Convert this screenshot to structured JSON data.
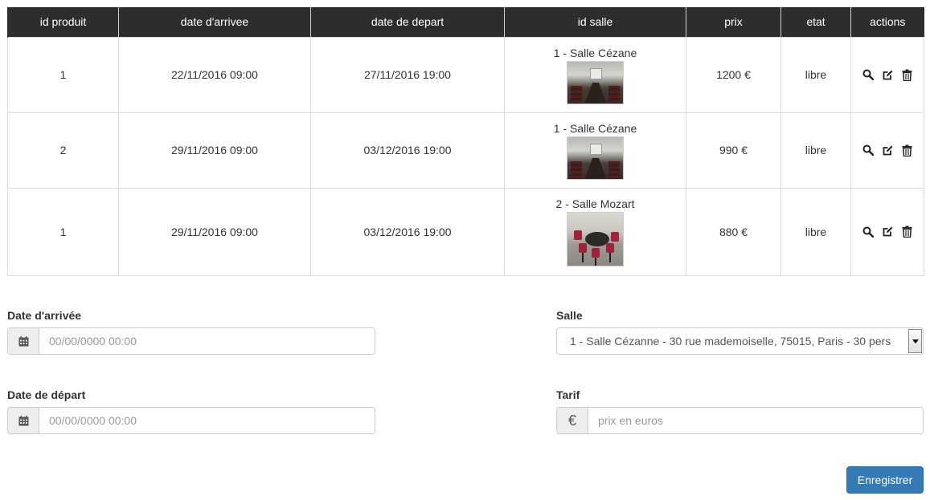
{
  "table": {
    "headers": [
      "id produit",
      "date d'arrivee",
      "date de depart",
      "id salle",
      "prix",
      "etat",
      "actions"
    ],
    "rows": [
      {
        "id_produit": "1",
        "date_arrivee": "22/11/2016 09:00",
        "date_depart": "27/11/2016 19:00",
        "salle": "1 - Salle Cézane",
        "prix": "1200 €",
        "etat": "libre"
      },
      {
        "id_produit": "2",
        "date_arrivee": "29/11/2016 09:00",
        "date_depart": "03/12/2016 19:00",
        "salle": "1 - Salle Cézane",
        "prix": "990 €",
        "etat": "libre"
      },
      {
        "id_produit": "1",
        "date_arrivee": "29/11/2016 09:00",
        "date_depart": "03/12/2016 19:00",
        "salle": "2 - Salle Mozart",
        "prix": "880 €",
        "etat": "libre"
      }
    ],
    "action_icons": [
      "search-icon",
      "edit-icon",
      "trash-icon"
    ]
  },
  "form": {
    "date_arrivee": {
      "label": "Date d'arrivée",
      "placeholder": "00/00/0000 00:00",
      "value": "",
      "icon": "calendar-icon"
    },
    "date_depart": {
      "label": "Date de départ",
      "placeholder": "00/00/0000 00:00",
      "value": "",
      "icon": "calendar-icon"
    },
    "salle": {
      "label": "Salle",
      "selected": "1 - Salle Cézanne - 30 rue mademoiselle, 75015, Paris - 30 pers"
    },
    "tarif": {
      "label": "Tarif",
      "placeholder": "prix en euros",
      "value": "",
      "addon": "€"
    },
    "submit_label": "Enregistrer"
  },
  "colors": {
    "header_bg": "#2d2d2d",
    "primary": "#337ab7",
    "border": "#dddddd",
    "addon_bg": "#eeeeee"
  }
}
